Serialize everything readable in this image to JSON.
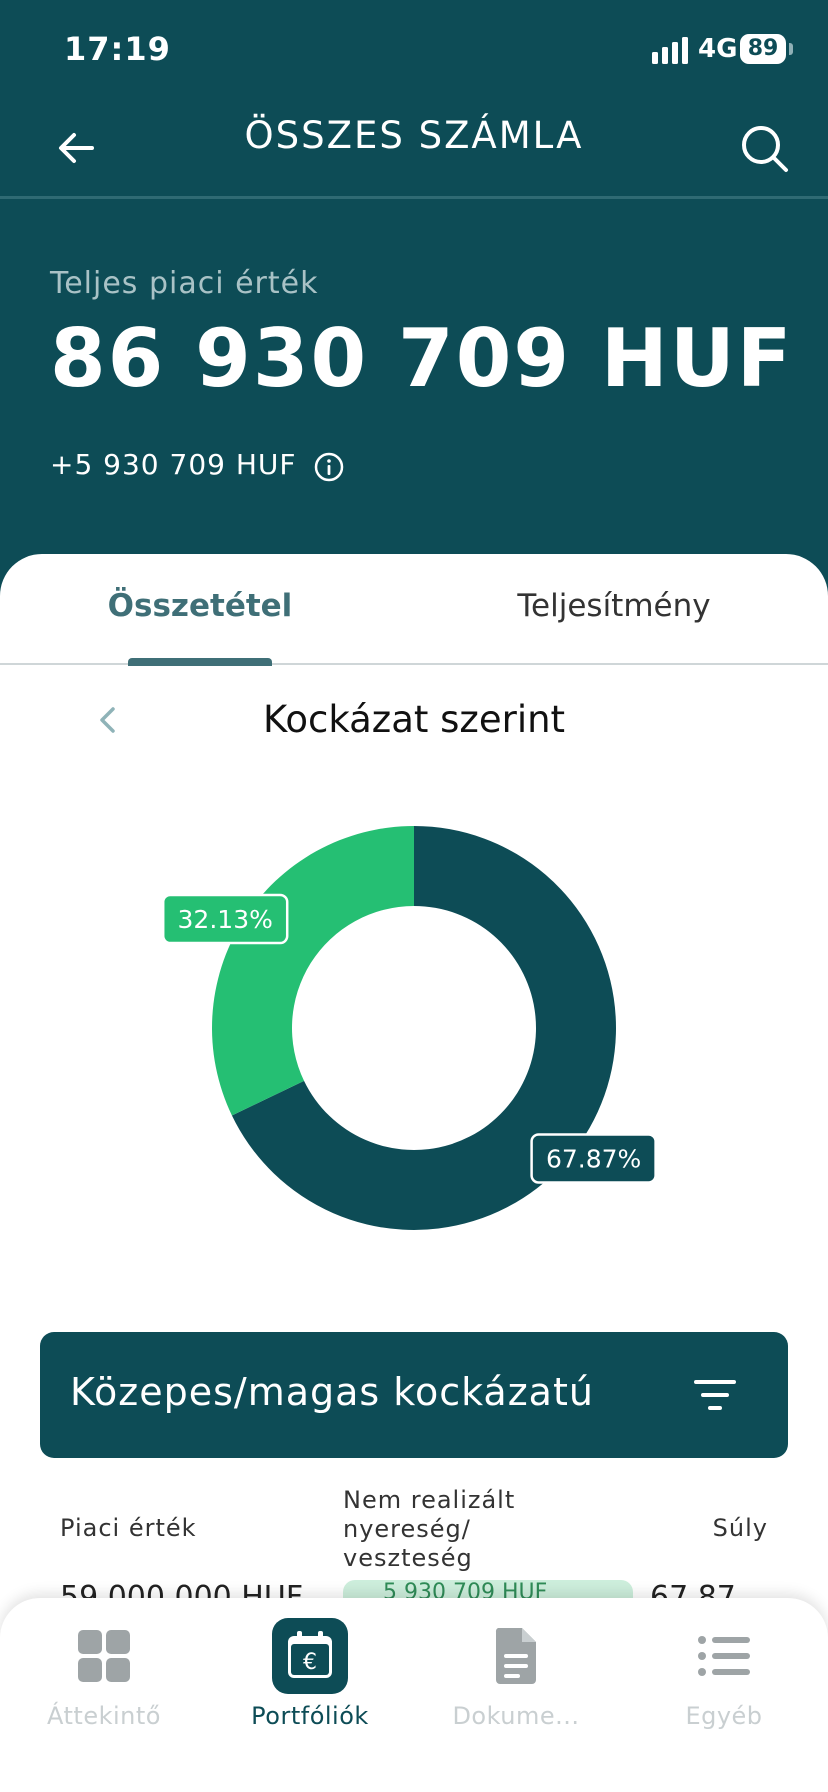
{
  "status_bar": {
    "time": "17:19",
    "network": "4G",
    "battery": "89"
  },
  "header": {
    "title": "ÖSSZES SZÁMLA"
  },
  "summary": {
    "label": "Teljes piaci érték",
    "value": "86 930 709 HUF",
    "gain": "+5 930 709 HUF"
  },
  "tabs": [
    {
      "label": "Összetétel",
      "active": true
    },
    {
      "label": "Teljesítmény",
      "active": false
    }
  ],
  "chart": {
    "title": "Kockázat szerint",
    "slice_labels": [
      "67.87%",
      "32.13%"
    ]
  },
  "chart_data": {
    "type": "pie",
    "title": "Kockázat szerint",
    "categories": [
      "Közepes/magas kockázatú",
      ""
    ],
    "values": [
      67.87,
      32.13
    ],
    "colors": [
      "#0d4c56",
      "#25bf73"
    ],
    "donut": true
  },
  "category_box": {
    "label": "Közepes/magas kockázatú"
  },
  "table_header": {
    "market_value": "Piaci érték",
    "unrealized": "Nem realizált nyereség/ veszteség",
    "weight": "Súly"
  },
  "table_peek": {
    "market_value": "59 000 000 HUF",
    "unrealized": "5 930 709 HUF",
    "weight": "67.87 %"
  },
  "bottom_nav": [
    {
      "label": "Áttekintő",
      "icon": "grid-icon",
      "active": false
    },
    {
      "label": "Portfóliók",
      "icon": "euro-calendar-icon",
      "active": true
    },
    {
      "label": "Dokume...",
      "icon": "document-icon",
      "active": false
    },
    {
      "label": "Egyéb",
      "icon": "list-icon",
      "active": false
    }
  ]
}
